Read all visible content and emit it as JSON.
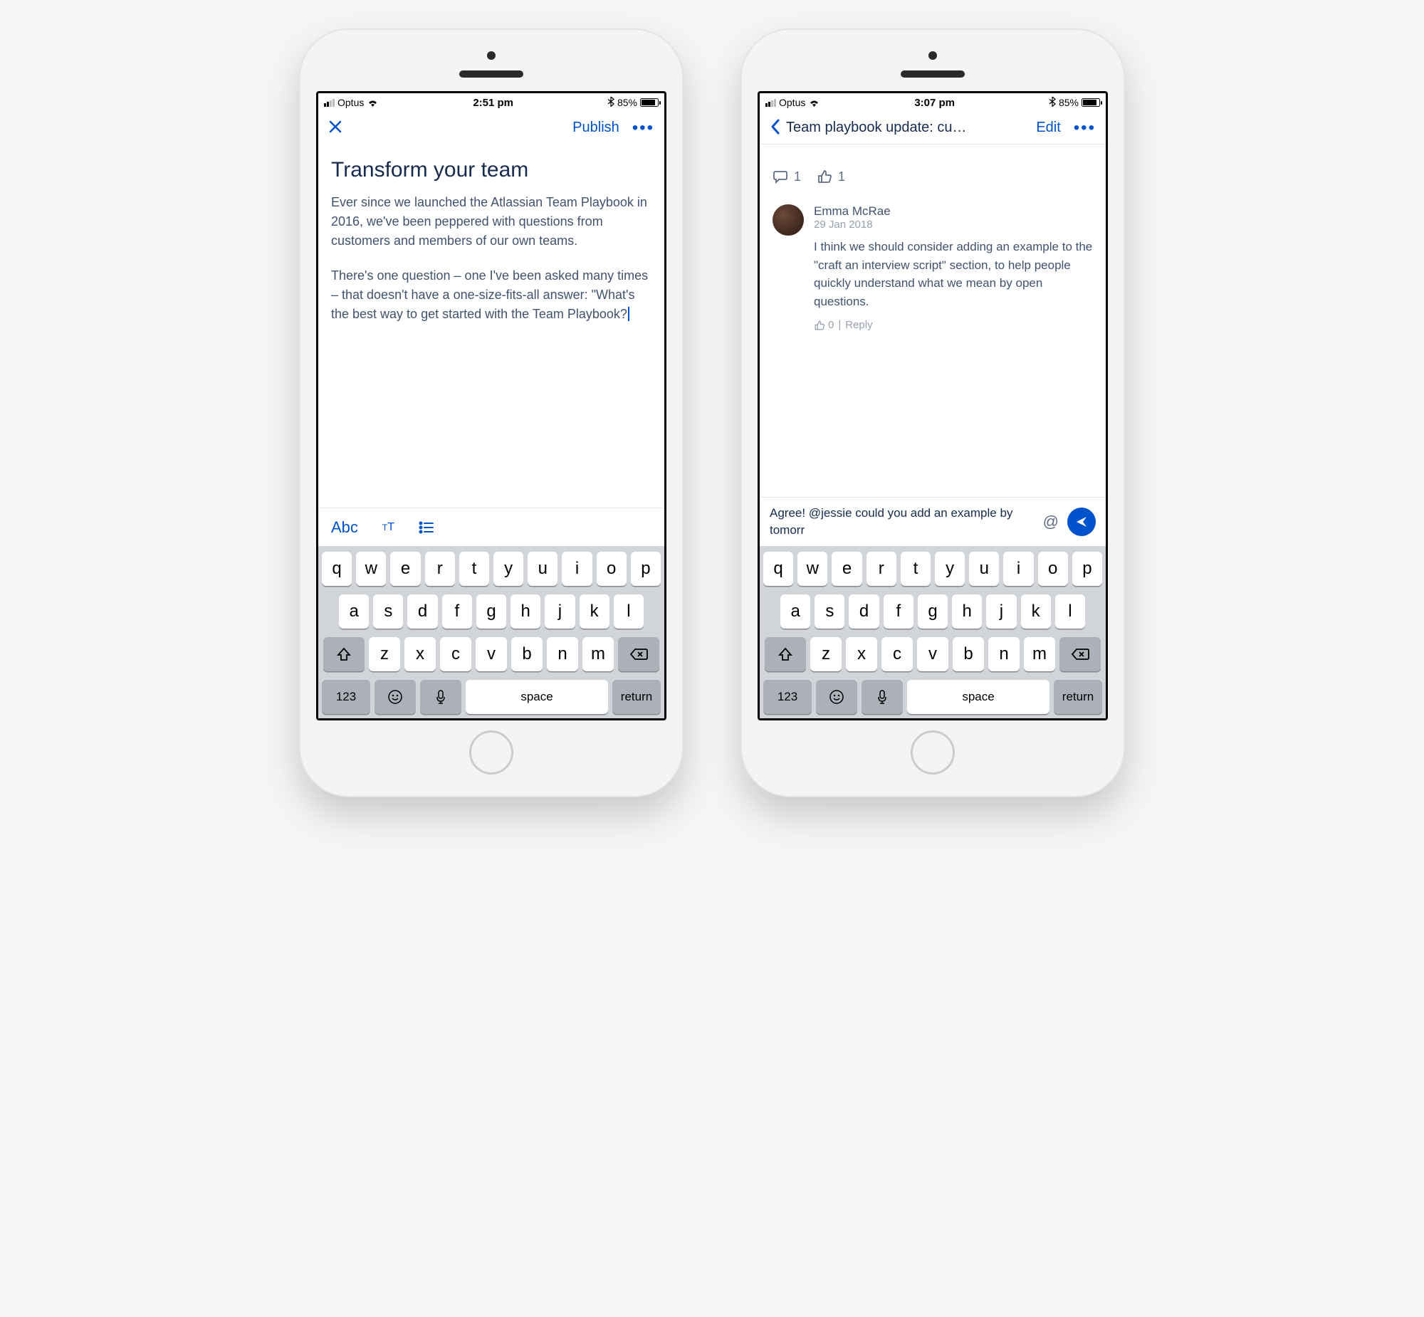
{
  "phone1": {
    "status": {
      "carrier": "Optus",
      "time": "2:51 pm",
      "battery": "85%"
    },
    "nav": {
      "publish": "Publish"
    },
    "heading": "Transform your team",
    "para1": "Ever since we launched the Atlassian Team Playbook in 2016, we've been peppered with questions from customers and members of our own teams.",
    "para2": "There's one question – one I've been asked many times – that doesn't have a one-size-fits-all answer: \"What's the best way to get started with the Team Playbook?",
    "toolbar_abc": "Abc"
  },
  "phone2": {
    "status": {
      "carrier": "Optus",
      "time": "3:07 pm",
      "battery": "85%"
    },
    "nav": {
      "title": "Team playbook update: cu…",
      "edit": "Edit"
    },
    "stats": {
      "comments": "1",
      "likes": "1"
    },
    "comment": {
      "author": "Emma McRae",
      "date": "29 Jan 2018",
      "text": "I think we should consider adding an example to the \"craft an interview script\" section, to help people quickly understand what we mean by open questions.",
      "likes": "0",
      "reply_label": "Reply"
    },
    "reply_draft": "Agree!  @jessie could you add an example by tomorr"
  },
  "keyboard": {
    "row1": [
      "q",
      "w",
      "e",
      "r",
      "t",
      "y",
      "u",
      "i",
      "o",
      "p"
    ],
    "row2": [
      "a",
      "s",
      "d",
      "f",
      "g",
      "h",
      "j",
      "k",
      "l"
    ],
    "row3": [
      "z",
      "x",
      "c",
      "v",
      "b",
      "n",
      "m"
    ],
    "nums": "123",
    "space": "space",
    "return": "return"
  }
}
